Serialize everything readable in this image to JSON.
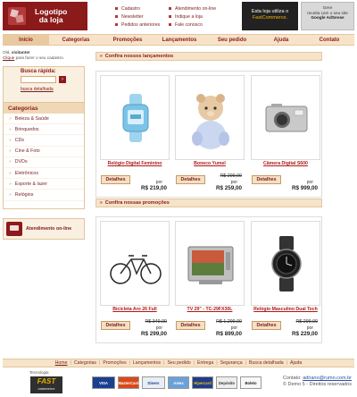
{
  "header": {
    "logo_text_line1": "Logotipo",
    "logo_text_line2": "da loja",
    "links": [
      "Cadastro",
      "Atendimento on-line",
      "Newsletter",
      "Indique a loja",
      "Pedidos anteriores",
      "Fale conosco"
    ],
    "fast_line1": "Esta loja utiliza o",
    "fast_line2": "FastCommerce.",
    "ads_line1": "Gere",
    "ads_line2": "receita com o seu site",
    "ads_line3": "Google AdSense"
  },
  "nav": [
    "Início",
    "Categorias",
    "Promoções",
    "Lançamentos",
    "Seu pedido",
    "Ajuda",
    "Contato"
  ],
  "sidebar": {
    "greet_hello": "Olá,",
    "greet_visitor": "visitante!",
    "greet_click": "Clique",
    "greet_rest": "para fazer o seu cadastro.",
    "search_title": "Busca rápida:",
    "search_value": "",
    "search_go": "›",
    "search_adv": "busca detalhada",
    "categories_title": "Categorias",
    "categories": [
      "Beleza & Saúde",
      "Brinquedos",
      "CDs",
      "Cine & Foto",
      "DVDs",
      "Eletrônicos",
      "Esporte & lazer",
      "Relógios"
    ],
    "chat_label": "Atendimento on-line"
  },
  "sections": {
    "launches_title": "Confira nossos lançamentos",
    "promos_title": "Confira nossas promoções"
  },
  "launches": [
    {
      "name": "Relógio Digital Feminino",
      "old_price": "",
      "por": "por",
      "price": "R$ 219,00",
      "details": "Detalhes",
      "icon": "watch-blue-icon"
    },
    {
      "name": "Boneco Yumel",
      "old_price": "R$ 299,00",
      "por": "por",
      "price": "R$ 259,00",
      "details": "Detalhes",
      "icon": "plush-toy-icon"
    },
    {
      "name": "Câmera Digital S600",
      "old_price": "",
      "por": "por",
      "price": "R$ 999,00",
      "details": "Detalhes",
      "icon": "camera-icon"
    }
  ],
  "promos": [
    {
      "name": "Bicicleta Aro 26 Full",
      "old_price": "R$ 349,00",
      "por": "por",
      "price": "R$ 299,00",
      "details": "Detalhes",
      "icon": "bicycle-icon"
    },
    {
      "name": "TV 29\" - TC-29FX30L",
      "old_price": "R$ 1.299,00",
      "por": "por",
      "price": "R$ 899,00",
      "details": "Detalhes",
      "icon": "tv-icon"
    },
    {
      "name": "Relógio Masculino Dual Tech",
      "old_price": "R$ 299,00",
      "por": "por",
      "price": "R$ 229,00",
      "details": "Detalhes",
      "icon": "watch-black-icon"
    }
  ],
  "footer": {
    "links": [
      "Home",
      "Categorias",
      "Promoções",
      "Lançamentos",
      "Seu pedido",
      "Entrega",
      "Segurança",
      "Busca detalhada",
      "Ajuda"
    ],
    "tech_label": "Tecnologia",
    "fast_logo": "FAST",
    "fast_logo_sub": "commerce",
    "payments": [
      "VISA",
      "MasterCard",
      "Diners",
      "Amex",
      "Hipercard",
      "Depósito",
      "Boleto"
    ],
    "contact_label": "Contato:",
    "contact_email": "adriano@rumo.com.br",
    "copyright": "© Demo 5 - Direitos reservados"
  },
  "colors": {
    "brand": "#8b1a1a",
    "accent": "#f6e3c9",
    "price_link": "#b01818"
  }
}
